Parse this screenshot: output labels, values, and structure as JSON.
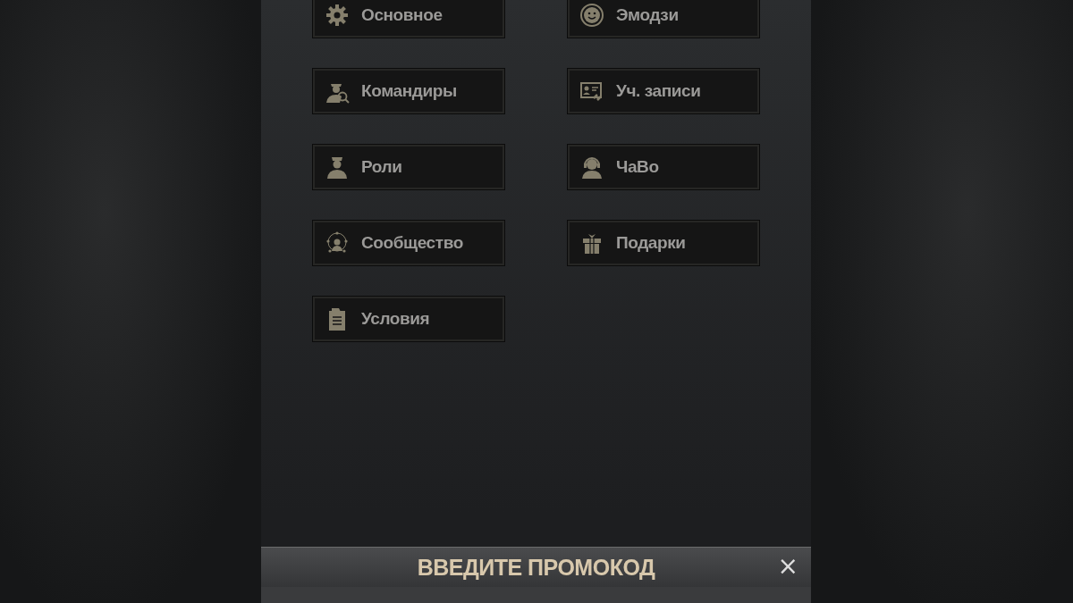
{
  "menu": [
    {
      "label": "Основное",
      "kind": "gear"
    },
    {
      "label": "Эмодзи",
      "kind": "smiley"
    },
    {
      "label": "Командиры",
      "kind": "officer-search"
    },
    {
      "label": "Уч. записи",
      "kind": "card-link"
    },
    {
      "label": "Роли",
      "kind": "officer"
    },
    {
      "label": "ЧаВо",
      "kind": "headset"
    },
    {
      "label": "Сообщество",
      "kind": "network"
    },
    {
      "label": "Подарки",
      "kind": "gift"
    },
    {
      "label": "Условия",
      "kind": "clipboard"
    }
  ],
  "promo_bar": {
    "title": "ВВЕДИТЕ ПРОМОКОД",
    "close": "×"
  }
}
